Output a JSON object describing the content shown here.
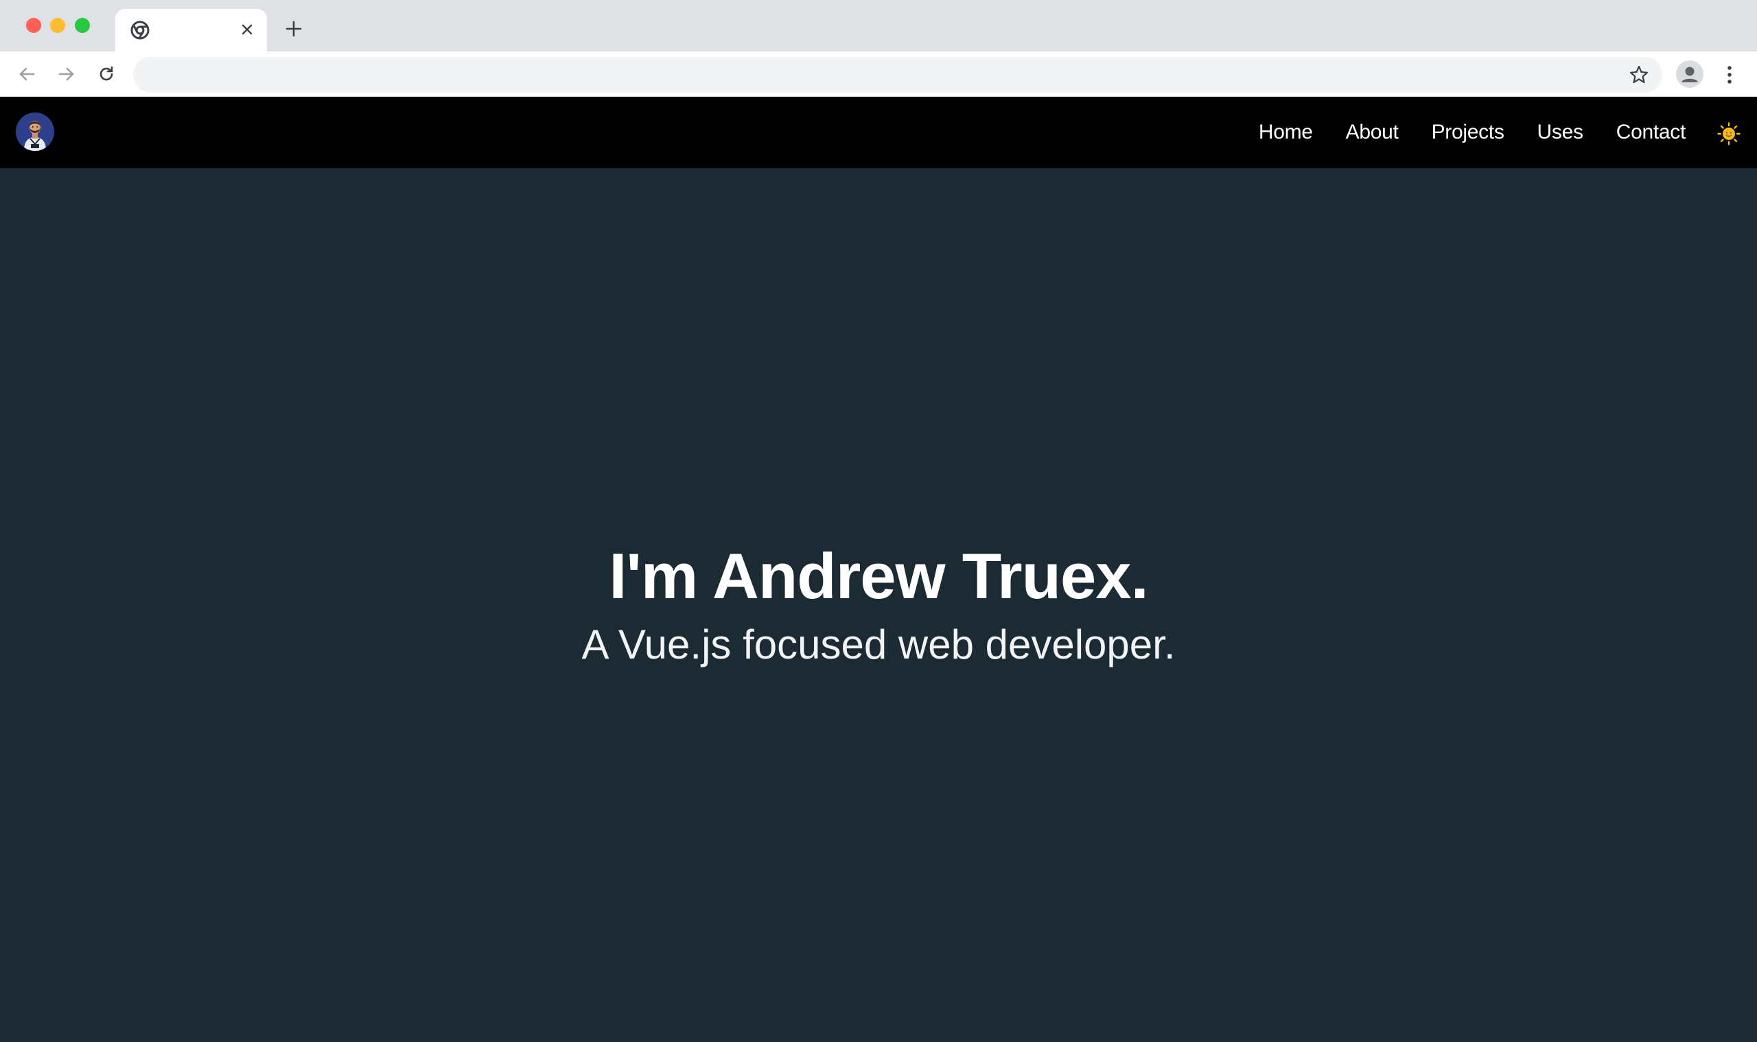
{
  "browser": {
    "tab": {
      "favicon": "chrome-icon",
      "close_icon": "close-icon"
    },
    "new_tab_icon": "plus-icon",
    "toolbar": {
      "back_icon": "arrow-left-icon",
      "forward_icon": "arrow-right-icon",
      "reload_icon": "reload-icon",
      "address_value": "",
      "bookmark_icon": "star-icon",
      "profile_icon": "profile-icon",
      "menu_icon": "kebab-icon"
    }
  },
  "site": {
    "logo": "avatar-logo",
    "nav": [
      {
        "label": "Home"
      },
      {
        "label": "About"
      },
      {
        "label": "Projects"
      },
      {
        "label": "Uses"
      },
      {
        "label": "Contact"
      }
    ],
    "theme_toggle_icon": "sun-icon"
  },
  "hero": {
    "title": "I'm Andrew Truex.",
    "subtitle": "A Vue.js focused web developer."
  },
  "colors": {
    "nav_background": "#000000",
    "page_background": "#1c2a33",
    "text": "#ffffff",
    "sun": "#f6b81e"
  }
}
